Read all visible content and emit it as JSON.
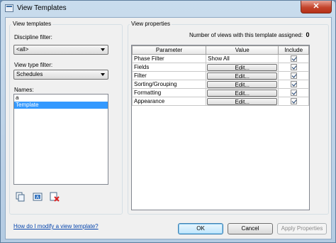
{
  "window": {
    "title": "View Templates",
    "close_glyph": "✕"
  },
  "left": {
    "group_label": "View templates",
    "discipline_label": "Discipline filter:",
    "discipline_value": "<all>",
    "view_type_label": "View type filter:",
    "view_type_value": "Schedules",
    "names_label": "Names:",
    "names": [
      {
        "label": "a",
        "selected": false
      },
      {
        "label": "Template",
        "selected": true
      }
    ],
    "tool_icons": [
      "duplicate-icon",
      "rename-icon",
      "delete-icon"
    ]
  },
  "right": {
    "group_label": "View properties",
    "count_label": "Number of views with this template assigned:",
    "count_value": "0",
    "columns": [
      "Parameter",
      "Value",
      "Include"
    ],
    "rows": [
      {
        "parameter": "Phase Filter",
        "value": "Show All",
        "is_button": false,
        "include": true
      },
      {
        "parameter": "Fields",
        "value": "Edit...",
        "is_button": true,
        "include": true
      },
      {
        "parameter": "Filter",
        "value": "Edit...",
        "is_button": true,
        "include": true
      },
      {
        "parameter": "Sorting/Grouping",
        "value": "Edit...",
        "is_button": true,
        "include": true
      },
      {
        "parameter": "Formatting",
        "value": "Edit...",
        "is_button": true,
        "include": true
      },
      {
        "parameter": "Appearance",
        "value": "Edit...",
        "is_button": true,
        "include": true
      }
    ]
  },
  "footer": {
    "help_link": "How do I modify a view template?",
    "ok": "OK",
    "cancel": "Cancel",
    "apply": "Apply Properties"
  }
}
